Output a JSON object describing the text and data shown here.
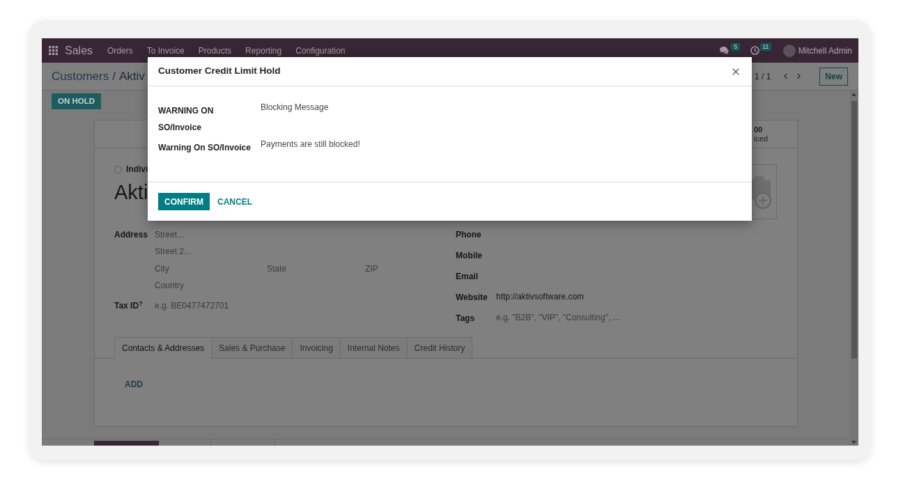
{
  "navbar": {
    "app_name": "Sales",
    "menu": [
      {
        "label": "Orders"
      },
      {
        "label": "To Invoice"
      },
      {
        "label": "Products"
      },
      {
        "label": "Reporting"
      },
      {
        "label": "Configuration"
      }
    ],
    "messages_badge": "5",
    "activities_badge": "11",
    "user_name": "Mitchell Admin"
  },
  "control_panel": {
    "breadcrumb": [
      "Customers",
      "Aktiv"
    ],
    "separator": "/",
    "pager": "1 / 1",
    "new_button": "New"
  },
  "statusbar": {
    "buttons": [
      {
        "label": "ON HOLD"
      }
    ]
  },
  "form": {
    "stat_button": {
      "value": "00",
      "label": "iced"
    },
    "company_type": {
      "label": "Indivi",
      "selected": false
    },
    "name": "Akti",
    "address": {
      "label": "Address",
      "rows": [
        {
          "fields": [
            {
              "placeholder": "Street..."
            }
          ]
        },
        {
          "fields": [
            {
              "placeholder": "Street 2..."
            }
          ]
        },
        {
          "fields": [
            {
              "placeholder": "City"
            },
            {
              "placeholder": "State"
            },
            {
              "placeholder": "ZIP"
            }
          ]
        },
        {
          "fields": [
            {
              "placeholder": "Country"
            }
          ]
        }
      ]
    },
    "tax_id": {
      "label": "Tax ID$^{?}$",
      "placeholder": "e.g. BE0477472701"
    },
    "contact_fields": [
      {
        "label": "Phone"
      },
      {
        "label": "Mobile"
      },
      {
        "label": "Email"
      },
      {
        "label": "Website",
        "value": "http://aktivsoftware.com"
      },
      {
        "label": "Tags",
        "placeholder": "e.g. \"B2B\", \"VIP\", \"Consulting\", ..."
      }
    ],
    "tabs": [
      {
        "label": "Contacts & Addresses",
        "selected": true
      },
      {
        "label": "Sales & Purchase",
        "selected": false
      },
      {
        "label": "Invoicing",
        "selected": false
      },
      {
        "label": "Internal Notes",
        "selected": false
      },
      {
        "label": "Credit History",
        "selected": false
      }
    ],
    "add_button": "ADD"
  },
  "dialog": {
    "title": "Customer Credit Limit Hold",
    "rows": [
      {
        "label": "WARNING ON SO/Invoice",
        "value": "Blocking Message"
      },
      {
        "label": "Warning On SO/Invoice",
        "value": "Payments are still blocked!"
      }
    ],
    "buttons": [
      {
        "label": "CONFIRM",
        "kind": "primary"
      },
      {
        "label": "CANCEL",
        "kind": "link"
      }
    ]
  }
}
